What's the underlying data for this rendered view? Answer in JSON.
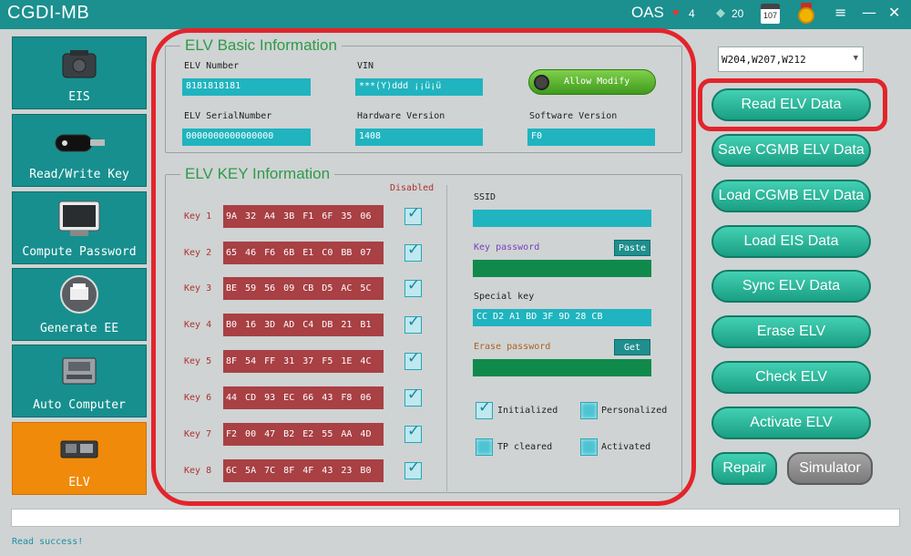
{
  "titlebar": {
    "app_title": "CGDI-MB",
    "oas": "OAS",
    "hearts": "4",
    "diamonds": "20",
    "calendar": "107",
    "win_menu": "≡",
    "win_min": "—",
    "win_close": "✕"
  },
  "sidebar": {
    "items": [
      {
        "label": "EIS",
        "icon": "eis-module-icon"
      },
      {
        "label": "Read/Write Key",
        "icon": "car-key-icon"
      },
      {
        "label": "Compute Password",
        "icon": "computer-icon"
      },
      {
        "label": "Generate EE",
        "icon": "printer-icon"
      },
      {
        "label": "Auto Computer",
        "icon": "ecu-module-icon"
      },
      {
        "label": "ELV",
        "icon": "elv-module-icon",
        "active": true
      }
    ]
  },
  "elv_basic": {
    "title": "ELV Basic Information",
    "elv_number_label": "ELV Number",
    "elv_number": "8181818181",
    "vin_label": "VIN",
    "vin": "***(Y)ddd ¡¡ü¡ü",
    "allow_modify": "Allow Modify",
    "elv_serial_label": "ELV SerialNumber",
    "elv_serial": "0000000000000000",
    "hw_version_label": "Hardware Version",
    "hw_version": "1408",
    "sw_version_label": "Software Version",
    "sw_version": "F0"
  },
  "elv_key": {
    "title": "ELV KEY Information",
    "disabled_label": "Disabled",
    "keys": [
      {
        "label": "Key 1",
        "value": "9A 32 A4 3B F1 6F 35 06"
      },
      {
        "label": "Key 2",
        "value": "65 46 F6 6B E1 C0 BB 07"
      },
      {
        "label": "Key 3",
        "value": "BE 59 56 09 CB D5 AC 5C"
      },
      {
        "label": "Key 4",
        "value": "B0 16 3D AD C4 DB 21 B1"
      },
      {
        "label": "Key 5",
        "value": "8F 54 FF 31 37 F5 1E 4C"
      },
      {
        "label": "Key 6",
        "value": "44 CD 93 EC 66 43 F8 06"
      },
      {
        "label": "Key 7",
        "value": "F2 00 47 B2 E2 55 AA 4D"
      },
      {
        "label": "Key 8",
        "value": "6C 5A 7C 8F 4F 43 23 B0"
      }
    ],
    "ssid_label": "SSID",
    "ssid": "",
    "key_password_label": "Key password",
    "paste_button": "Paste",
    "key_password": "",
    "special_key_label": "Special key",
    "special_key": "CC D2 A1 BD 3F 9D 28 CB",
    "erase_password_label": "Erase password",
    "get_button": "Get",
    "erase_password": "",
    "flags": {
      "initialized": "Initialized",
      "personalized": "Personalized",
      "tp_cleared": "TP cleared",
      "activated": "Activated"
    }
  },
  "right_panel": {
    "model_select": "W204,W207,W212",
    "buttons": [
      "Read  ELV Data",
      "Save CGMB ELV Data",
      "Load CGMB ELV Data",
      "Load EIS Data",
      "Sync ELV Data",
      "Erase ELV",
      "Check ELV",
      "Activate ELV"
    ],
    "repair": "Repair",
    "simulator": "Simulator"
  },
  "status": "Read success!",
  "colors": {
    "titlebar": "#1c8f8f",
    "sidebar": "#178f8e",
    "sidebar_active": "#f08a0b",
    "highlight": "#e3242b",
    "field": "#1fb4bf",
    "key_field": "#a84044",
    "group_title": "#2f9a47"
  }
}
